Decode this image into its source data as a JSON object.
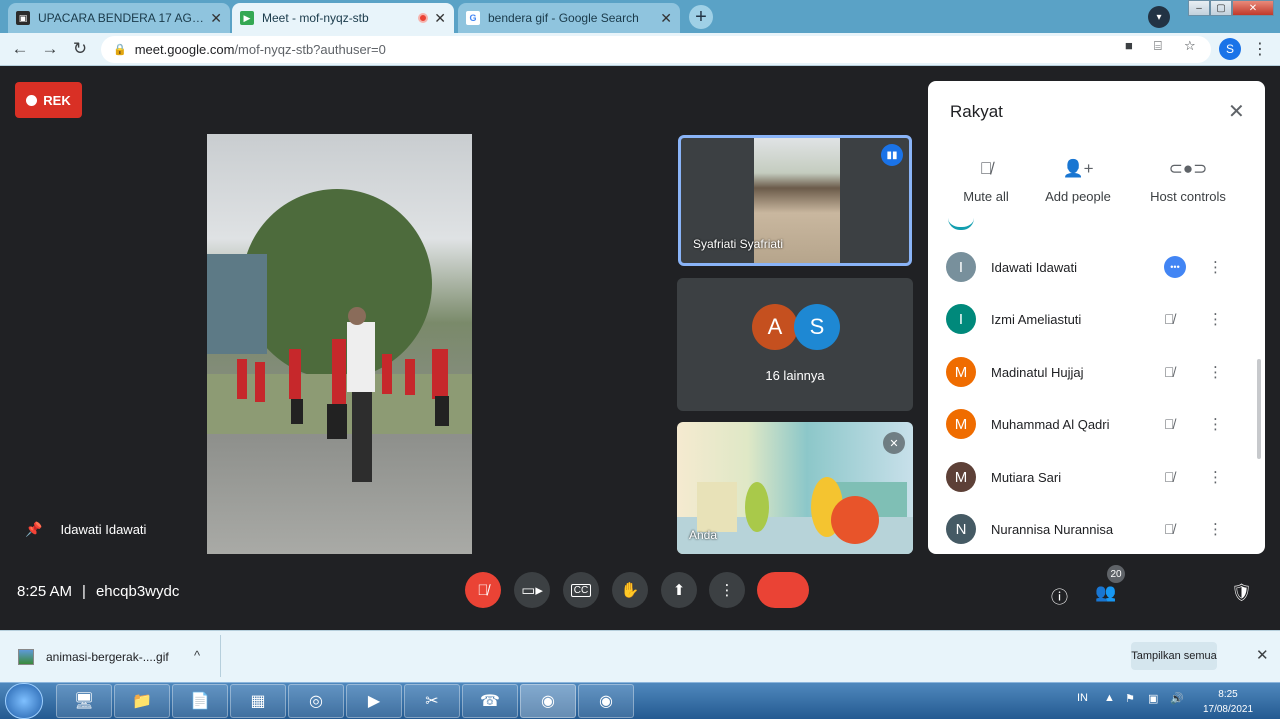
{
  "browser": {
    "tabs": [
      {
        "title": "UPACARA BENDERA 17 AGUSTUS",
        "favicon": "meet-camera-icon",
        "close": "✕"
      },
      {
        "title": "Meet - mof-nyqz-stb",
        "favicon": "google-meet-icon",
        "close": "✕",
        "recording": true
      },
      {
        "title": "bendera gif - Google Search",
        "favicon": "google-g-icon",
        "close": "✕"
      }
    ],
    "new_tab": "+",
    "url_domain": "meet.google.com",
    "url_path": "/mof-nyqz-stb?authuser=0",
    "profile_initial": "S"
  },
  "meet": {
    "rec_label": "REK",
    "pinned_name": "Idawati Idawati",
    "tiles": {
      "top_name": "Syafriati Syafriati",
      "avatars": [
        {
          "letter": "A",
          "color": "#c5501f"
        },
        {
          "letter": "S",
          "color": "#1e88d3"
        }
      ],
      "more_label": "16 lainnya",
      "self_name": "Anda"
    },
    "panel": {
      "title": "Rakyat",
      "actions": [
        {
          "label": "Mute all",
          "icon": "mic-off-icon"
        },
        {
          "label": "Add people",
          "icon": "add-person-icon"
        },
        {
          "label": "Host controls",
          "icon": "toggle-icon"
        }
      ],
      "people": [
        {
          "initial": "I",
          "name": "Idawati Idawati",
          "color": "#78909c",
          "speaking": true
        },
        {
          "initial": "I",
          "name": "Izmi Ameliastuti",
          "color": "#00897b",
          "speaking": false
        },
        {
          "initial": "M",
          "name": "Madinatul Hujjaj",
          "color": "#ef6c00",
          "speaking": false
        },
        {
          "initial": "M",
          "name": "Muhammad Al Qadri",
          "color": "#ef6c00",
          "speaking": false
        },
        {
          "initial": "M",
          "name": "Mutiara Sari",
          "color": "#5d4037",
          "speaking": false
        },
        {
          "initial": "N",
          "name": "Nurannisa Nurannisa",
          "color": "#455a64",
          "speaking": false
        }
      ]
    },
    "bottom": {
      "time": "8:25 AM",
      "separator": "|",
      "meeting_code": "ehcqb3wydc",
      "participant_count": "20"
    }
  },
  "downloads": {
    "file_name": "animasi-bergerak-....gif",
    "show_all": "Tampilkan semua"
  },
  "taskbar": {
    "language": "IN",
    "time": "8:25",
    "date": "17/08/2021"
  }
}
